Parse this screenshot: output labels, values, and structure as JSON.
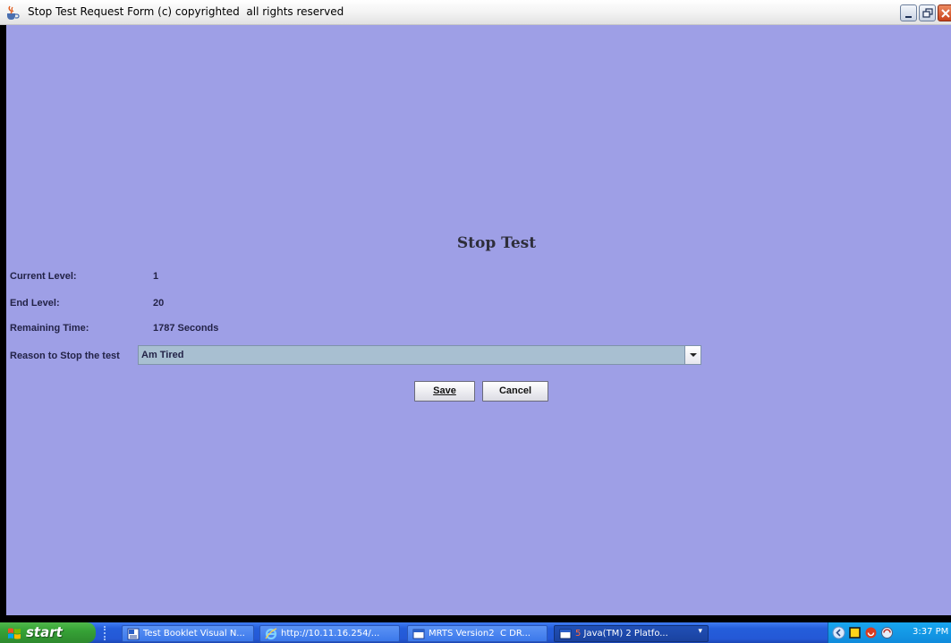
{
  "window": {
    "title": "Stop Test Request Form (c) copyrighted  all rights reserved",
    "icon": "java-cup-icon"
  },
  "form": {
    "heading": "Stop Test",
    "fields": [
      {
        "label": "Current Level:",
        "value": "1"
      },
      {
        "label": "End Level:",
        "value": "20"
      },
      {
        "label": "Remaining Time:",
        "value": "1787 Seconds"
      }
    ],
    "reason": {
      "label": "Reason to Stop the test",
      "selected": "Am Tired"
    },
    "buttons": {
      "save": "Save",
      "cancel": "Cancel"
    }
  },
  "taskbar": {
    "start_label": "start",
    "tasks": [
      {
        "label": "Test Booklet Visual N...",
        "icon": "word-icon"
      },
      {
        "label": "http://10.11.16.254/...",
        "icon": "internet-explorer-icon"
      },
      {
        "label": "MRTS Version2  C DR...",
        "icon": "window-icon"
      },
      {
        "badge": "5",
        "label": " Java(TM) 2 Platfo...",
        "icon": "java-window-icon"
      }
    ],
    "clock": "3:37 PM"
  },
  "colors": {
    "client_background": "#9e9fe6",
    "combo_background": "#a8bfd1",
    "taskbar_blue": "#245edb",
    "start_green": "#36a236"
  }
}
